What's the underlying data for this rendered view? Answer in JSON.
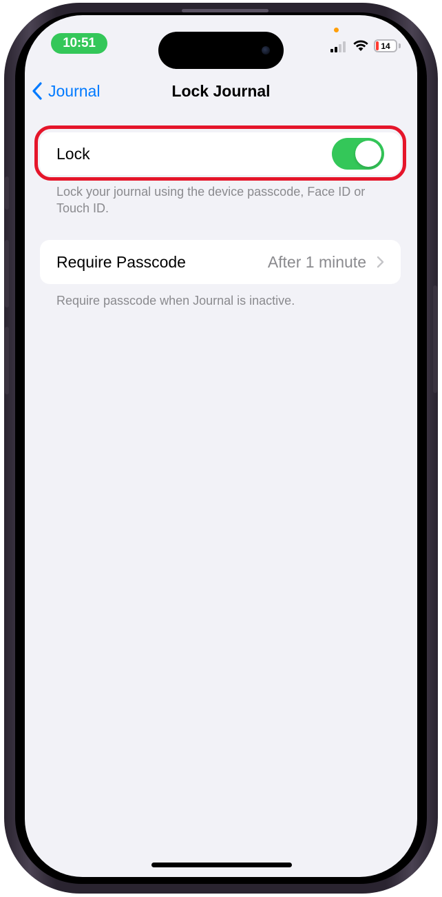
{
  "status_bar": {
    "time": "10:51",
    "battery_level": "14",
    "battery_percent": 14,
    "colors": {
      "time_pill": "#34c759",
      "battery_low": "#ff3b30",
      "privacy_dot": "#ff9f0a"
    },
    "icons": [
      "signal-icon",
      "wifi-icon",
      "battery-icon"
    ]
  },
  "nav": {
    "back_label": "Journal",
    "title": "Lock Journal",
    "accent": "#007aff"
  },
  "lock_row": {
    "label": "Lock",
    "enabled": true,
    "toggle_color": "#34c759",
    "highlight_color": "#e5152a"
  },
  "lock_footnote": "Lock your journal using the device passcode, Face ID or Touch ID.",
  "passcode_row": {
    "label": "Require Passcode",
    "value": "After 1 minute"
  },
  "passcode_footnote": "Require passcode when Journal is inactive."
}
